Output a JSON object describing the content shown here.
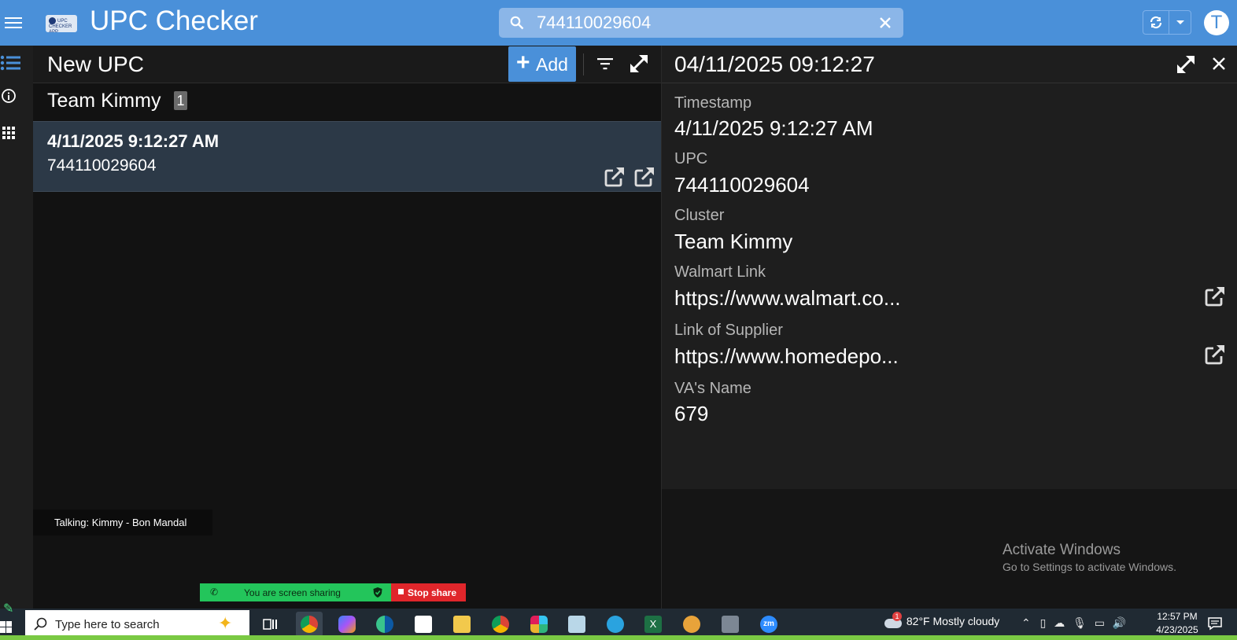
{
  "app": {
    "title": "UPC Checker",
    "logo_text": "UPC CHECKER APP",
    "search_value": "744110029604",
    "avatar_initial": "T"
  },
  "list": {
    "title": "New UPC",
    "add_label": "Add",
    "group": {
      "name": "Team Kimmy",
      "count": "1"
    },
    "rows": [
      {
        "timestamp": "4/11/2025 9:12:27 AM",
        "upc": "744110029604"
      }
    ]
  },
  "detail": {
    "title": "04/11/2025 09:12:27",
    "fields": [
      {
        "label": "Timestamp",
        "value": "4/11/2025 9:12:27 AM"
      },
      {
        "label": "UPC",
        "value": "744110029604"
      },
      {
        "label": "Cluster",
        "value": "Team Kimmy"
      },
      {
        "label": "Walmart Link",
        "value": "https://www.walmart.co..."
      },
      {
        "label": "Link of Supplier",
        "value": "https://www.homedepo..."
      },
      {
        "label": "VA's Name",
        "value": "679"
      }
    ]
  },
  "overlay": {
    "talking": "Talking: Kimmy - Bon Mandal",
    "sharing": "You are screen sharing",
    "stop_share": "Stop share"
  },
  "watermark": {
    "line1": "Activate Windows",
    "line2": "Go to Settings to activate Windows."
  },
  "taskbar": {
    "search_placeholder": "Type here to search",
    "weather": "82°F  Mostly cloudy",
    "weather_badge": "1",
    "time": "12:57 PM",
    "date": "4/23/2025",
    "apps": [
      "task-view",
      "chrome",
      "copilot",
      "edge",
      "store",
      "file-explorer",
      "chrome-profile",
      "slack",
      "notes",
      "telegram",
      "excel",
      "game",
      "calculator",
      "zoom"
    ]
  },
  "colors": {
    "accent": "#4a90d9",
    "row_selected": "#2c3947",
    "share_green": "#23c55b",
    "share_red": "#e0262b"
  }
}
